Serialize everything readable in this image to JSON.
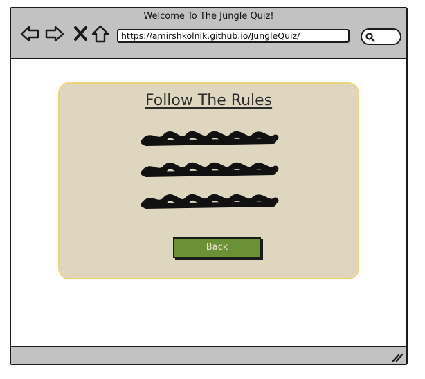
{
  "window": {
    "title": "Welcome To The Jungle Quiz!"
  },
  "browser": {
    "url": "https://amirshkolnik.github.io/JungleQuiz/",
    "nav_icons": [
      "back-arrow-icon",
      "forward-arrow-icon",
      "stop-icon",
      "home-icon"
    ],
    "search_icon": "search-icon"
  },
  "card": {
    "title": "Follow The Rules",
    "rule_lines": [
      "redacted",
      "redacted",
      "redacted"
    ],
    "back_label": "Back"
  },
  "colors": {
    "chrome": "#c2c2c2",
    "card_background": "#ded6be",
    "card_border": "#f2d37a",
    "button_green": "#6a9135",
    "button_text": "#e9e3cf"
  }
}
